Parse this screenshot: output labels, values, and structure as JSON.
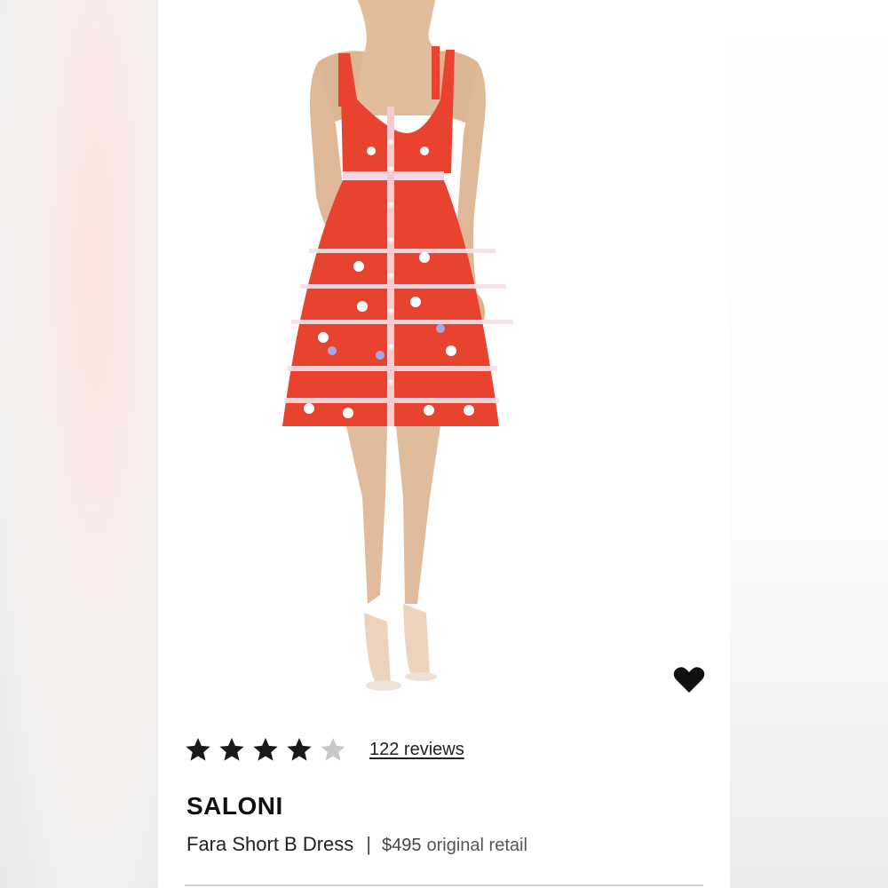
{
  "product": {
    "rating_value": 4,
    "rating_max": 5,
    "reviews_label": "122 reviews",
    "brand": "SALONI",
    "name": "Fara Short B Dress",
    "separator": "|",
    "price": "$495",
    "price_note": "original retail"
  },
  "icons": {
    "favorite": "heart-icon",
    "star": "star-icon"
  },
  "colors": {
    "dress_red": "#e8432e",
    "star_filled": "#1a1a1a",
    "star_empty": "#c8c8c8",
    "text": "#222222"
  }
}
